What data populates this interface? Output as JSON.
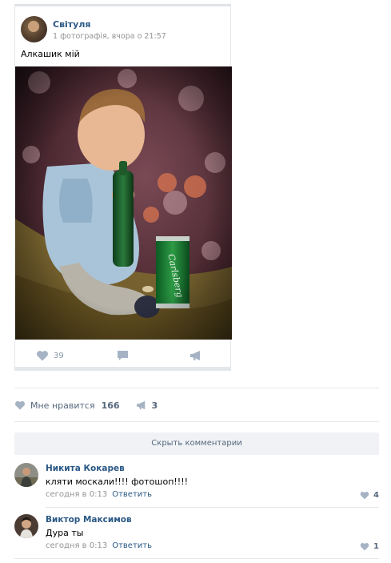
{
  "post": {
    "author": "Світуля",
    "meta": "1 фотографія, вчора о 21:57",
    "text": "Алкашик мій",
    "photo_icon": "photo-baby-with-beer",
    "likes_count": "39"
  },
  "stats": {
    "like_label": "Мне нравится",
    "like_count": "166",
    "share_count": "3"
  },
  "hide_comments_label": "Скрыть комментарии",
  "comments": [
    {
      "name": "Никита Кокарев",
      "text": "кляти москали!!!! фотошоп!!!!",
      "time": "сегодня в 0:13",
      "reply": "Ответить",
      "likes": "4"
    },
    {
      "name": "Виктор Максимов",
      "text": "Дура ты",
      "time": "сегодня в 0:13",
      "reply": "Ответить",
      "likes": "1"
    }
  ],
  "colors": {
    "link": "#2a5885",
    "muted": "#939393",
    "icon": "#a5b3c4"
  }
}
